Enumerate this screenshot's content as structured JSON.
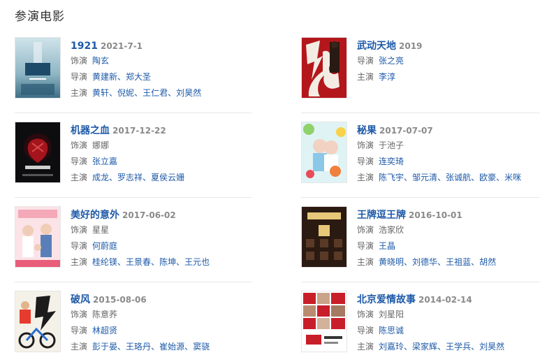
{
  "section_title": "参演电影",
  "movies": [
    {
      "title": "1921",
      "date": "2021-7-1",
      "rows": [
        {
          "label": "饰演",
          "value": "陶玄",
          "linked": true
        },
        {
          "label": "导演",
          "names": [
            "黄建新",
            "郑大圣"
          ]
        },
        {
          "label": "主演",
          "names": [
            "黄轩",
            "倪妮",
            "王仁君",
            "刘昊然"
          ]
        }
      ],
      "poster_text": "1921",
      "poster_sub": "2021.7.1"
    },
    {
      "title": "武动天地",
      "date": "2019",
      "rows": [
        {
          "label": "导演",
          "names": [
            "张之亮"
          ]
        },
        {
          "label": "主演",
          "names": [
            "李淳"
          ]
        }
      ]
    },
    {
      "title": "机器之血",
      "date": "2017-12-22",
      "rows": [
        {
          "label": "饰演",
          "value": "娜娜",
          "linked": false
        },
        {
          "label": "导演",
          "names": [
            "张立嘉"
          ]
        },
        {
          "label": "主演",
          "names": [
            "成龙",
            "罗志祥",
            "夏侯云姗"
          ]
        }
      ]
    },
    {
      "title": "秘果",
      "date": "2017-07-07",
      "rows": [
        {
          "label": "饰演",
          "value": "于池子",
          "linked": false
        },
        {
          "label": "导演",
          "names": [
            "连奕琦"
          ]
        },
        {
          "label": "主演",
          "names": [
            "陈飞宇",
            "邹元清",
            "张诚航",
            "欧豪",
            "米咪"
          ]
        }
      ]
    },
    {
      "title": "美好的意外",
      "date": "2017-06-02",
      "rows": [
        {
          "label": "饰演",
          "value": "星星",
          "linked": false
        },
        {
          "label": "导演",
          "names": [
            "何蔚庭"
          ]
        },
        {
          "label": "主演",
          "names": [
            "桂纶镁",
            "王景春",
            "陈坤",
            "王元也"
          ]
        }
      ]
    },
    {
      "title": "王牌逗王牌",
      "date": "2016-10-01",
      "rows": [
        {
          "label": "饰演",
          "value": "浩家欣",
          "linked": false
        },
        {
          "label": "导演",
          "names": [
            "王晶"
          ]
        },
        {
          "label": "主演",
          "names": [
            "黄晓明",
            "刘德华",
            "王祖蓝",
            "胡然"
          ]
        }
      ]
    },
    {
      "title": "破风",
      "date": "2015-08-06",
      "rows": [
        {
          "label": "饰演",
          "value": "陈意荞",
          "linked": false
        },
        {
          "label": "导演",
          "names": [
            "林超贤"
          ]
        },
        {
          "label": "主演",
          "names": [
            "彭于晏",
            "王珞丹",
            "崔始源",
            "窦骁"
          ]
        }
      ]
    },
    {
      "title": "北京爱情故事",
      "date": "2014-02-14",
      "rows": [
        {
          "label": "饰演",
          "value": "刘星阳",
          "linked": false
        },
        {
          "label": "导演",
          "names": [
            "陈思诚"
          ]
        },
        {
          "label": "主演",
          "names": [
            "刘嘉玲",
            "梁家辉",
            "王学兵",
            "刘昊然"
          ]
        }
      ]
    }
  ],
  "colors": {
    "link": "#1e5aa8",
    "label": "#666666",
    "date": "#8a8a8a",
    "divider": "#e8e8e8"
  }
}
